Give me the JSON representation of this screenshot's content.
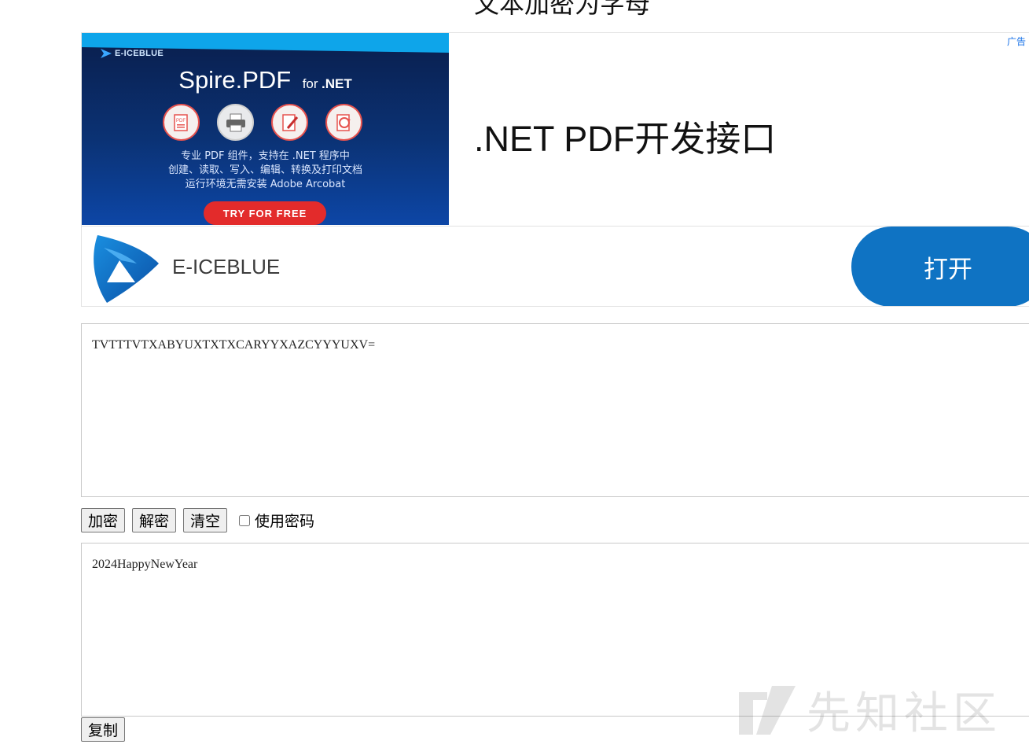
{
  "page": {
    "title": "文本加密为字母"
  },
  "ad": {
    "tag": "广告",
    "banner": {
      "brand": "E-ICEBLUE",
      "product_name": "Spire.PDF",
      "product_for": "for",
      "product_platform": ".NET",
      "desc_line1": "专业 PDF 组件，支持在 .NET 程序中",
      "desc_line2": "创建、读取、写入、编辑、转换及打印文档",
      "desc_line3": "运行环境无需安装 Adobe Arcobat",
      "cta": "TRY FOR FREE"
    },
    "headline": ".NET PDF开发接口",
    "advertiser": "E-ICEBLUE",
    "open_label": "打开"
  },
  "input": {
    "value": "TVTTTVTXABYUXTXTXCARYYXAZCYYYUXV="
  },
  "toolbar": {
    "encrypt_label": "加密",
    "decrypt_label": "解密",
    "clear_label": "清空",
    "use_password_label": "使用密码",
    "use_password_checked": false
  },
  "output": {
    "value": "2024HappyNewYear"
  },
  "copy_label": "复制",
  "watermark": {
    "text": "先知社区"
  },
  "colors": {
    "open_button": "#0f73c3",
    "cta": "#e32b2b",
    "banner_bg": "#0b3274"
  }
}
